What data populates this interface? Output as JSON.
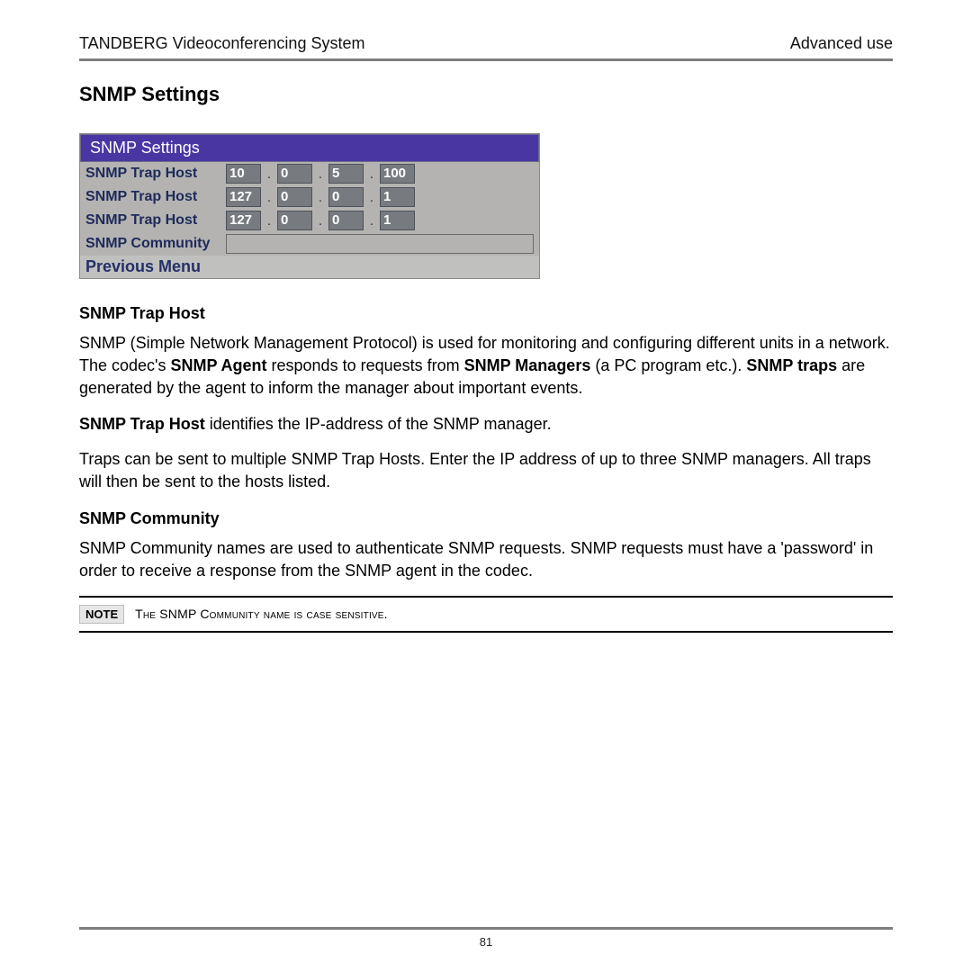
{
  "header": {
    "center": "TANDBERG Videoconferencing System",
    "right": "Advanced use"
  },
  "section_title": "SNMP Settings",
  "panel": {
    "title": "SNMP  Settings",
    "rows": [
      {
        "label": "SNMP  Trap Host",
        "octets": [
          "10",
          "0",
          "5",
          "100"
        ]
      },
      {
        "label": "SNMP  Trap Host",
        "octets": [
          "127",
          "0",
          "0",
          "1"
        ]
      },
      {
        "label": "SNMP  Trap Host",
        "octets": [
          "127",
          "0",
          "0",
          "1"
        ]
      }
    ],
    "community_label": "SNMP  Community",
    "community_value": "",
    "previous": "Previous  Menu"
  },
  "sub1_heading": "SNMP Trap Host",
  "para1a": "SNMP (Simple Network Management Protocol) is used for monitoring and configuring different units in a network. The codec's ",
  "para1b": "SNMP Agent",
  "para1c": " responds to requests from ",
  "para1d": "SNMP Managers",
  "para1e": " (a PC program etc.). ",
  "para1f": "SNMP traps",
  "para1g": " are generated by the agent to inform the manager about important events.",
  "para2a": "SNMP Trap Host",
  "para2b": " identifies the IP-address of the SNMP manager.",
  "para3": "Traps can be sent to multiple SNMP Trap Hosts. Enter the IP address of up to three SNMP managers. All traps will then be sent to the hosts listed.",
  "sub2_heading": "SNMP Community",
  "para4": "SNMP Community names are used to authenticate SNMP requests. SNMP requests must have a 'password' in order to receive a response from the SNMP agent in the codec.",
  "note_badge": "NOTE",
  "note_text_a": "T",
  "note_text_b": "he SNMP C",
  "note_text_c": "ommunity name is case sensitive.",
  "page_number": "81"
}
